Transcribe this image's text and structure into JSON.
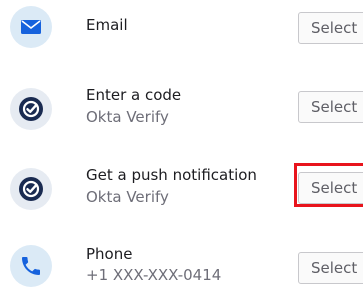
{
  "factors": [
    {
      "title": "Email",
      "subtitle": "",
      "icon": "email-icon",
      "button": "Select"
    },
    {
      "title": "Enter a code",
      "subtitle": "Okta Verify",
      "icon": "okta-verify-icon",
      "button": "Select"
    },
    {
      "title": "Get a push notification",
      "subtitle": "Okta Verify",
      "icon": "okta-verify-icon",
      "button": "Select",
      "highlighted": true
    },
    {
      "title": "Phone",
      "subtitle": "+1 XXX-XXX-0414",
      "icon": "phone-icon",
      "button": "Select"
    }
  ],
  "colors": {
    "icon_bg": "#dbeaf6",
    "brand_blue": "#1662dd",
    "okta_navy": "#1a2b51",
    "highlight_red": "#e8141c"
  }
}
